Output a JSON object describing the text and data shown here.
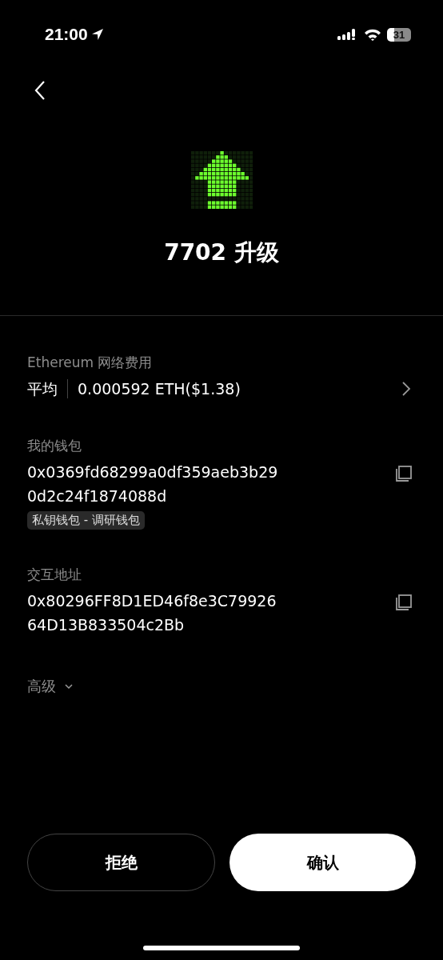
{
  "status_bar": {
    "time": "21:00",
    "battery": "31"
  },
  "header": {
    "title": "7702 升级"
  },
  "fee": {
    "label": "Ethereum 网络费用",
    "speed": "平均",
    "amount": "0.000592 ETH($1.38)"
  },
  "wallet": {
    "label": "我的钱包",
    "address_lines": [
      "0x0369fd68299a0df359aeb3b29",
      "0d2c24f1874088d"
    ],
    "tag": "私钥钱包 - 调研钱包"
  },
  "contract": {
    "label": "交互地址",
    "address_lines": [
      "0x80296FF8D1ED46f8e3C79926",
      "64D13B833504c2Bb"
    ]
  },
  "advanced": {
    "label": "高级",
    "expanded": false
  },
  "buttons": [
    {
      "label": "拒绝",
      "kind": "secondary"
    },
    {
      "label": "确认",
      "kind": "primary"
    }
  ]
}
